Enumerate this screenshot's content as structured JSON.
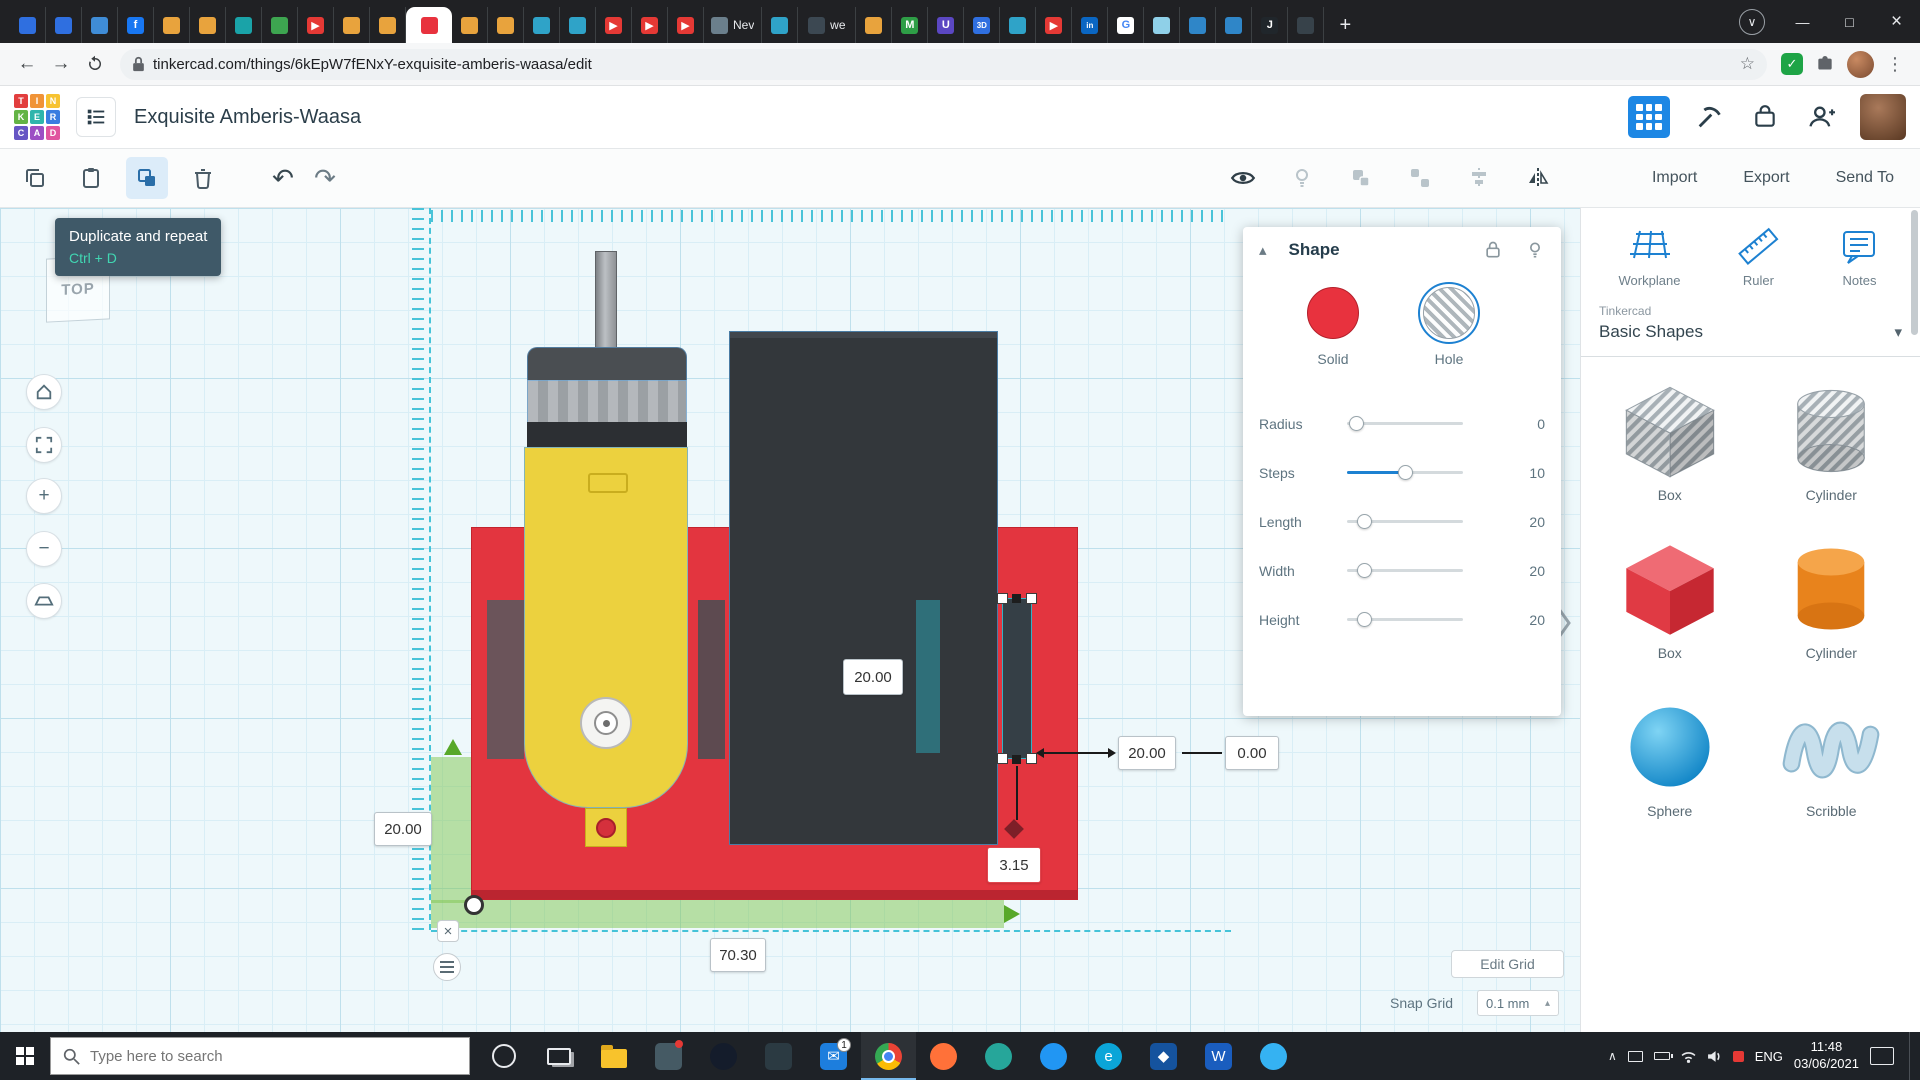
{
  "browser": {
    "tabs": [
      {
        "name": "translate",
        "color": "#2f6fe0"
      },
      {
        "name": "translate2",
        "color": "#2f6fe0"
      },
      {
        "name": "docs",
        "color": "#3f8cd6"
      },
      {
        "name": "facebook",
        "color": "#1877f2",
        "glyph": "f"
      },
      {
        "name": "amber1",
        "color": "#e8a33d"
      },
      {
        "name": "amber2",
        "color": "#e8a33d"
      },
      {
        "name": "maker",
        "color": "#1aa3a8"
      },
      {
        "name": "green",
        "color": "#3da550"
      },
      {
        "name": "youtube1",
        "color": "#e53935",
        "glyph": "▶"
      },
      {
        "name": "amber3",
        "color": "#e8a33d"
      },
      {
        "name": "amber4",
        "color": "#e8a33d"
      },
      {
        "name": "tinkercad",
        "color": "#e8323e",
        "active": true
      },
      {
        "name": "amber5",
        "color": "#e8a33d"
      },
      {
        "name": "amber6",
        "color": "#e8a33d"
      },
      {
        "name": "thing1",
        "color": "#2fa3c8"
      },
      {
        "name": "thing2",
        "color": "#2fa3c8"
      },
      {
        "name": "youtube2",
        "color": "#e53935",
        "glyph": "▶"
      },
      {
        "name": "youtube3",
        "color": "#e53935",
        "glyph": "▶"
      },
      {
        "name": "youtube4",
        "color": "#e53935",
        "glyph": "▶"
      },
      {
        "name": "nev",
        "color": "#6b7f8c",
        "label": "Nev"
      },
      {
        "name": "thing3",
        "color": "#2fa3c8"
      },
      {
        "name": "wetransfer",
        "color": "#3c4852",
        "label": "we"
      },
      {
        "name": "amber7",
        "color": "#e8a33d"
      },
      {
        "name": "gmail",
        "color": "#2e9e46",
        "glyph": "M"
      },
      {
        "name": "ultimaker",
        "color": "#5b47c2",
        "glyph": "U"
      },
      {
        "name": "threed",
        "color": "#2f6fe0",
        "glyph": "3D"
      },
      {
        "name": "thing4",
        "color": "#2fa3c8"
      },
      {
        "name": "youtube5",
        "color": "#e53935",
        "glyph": "▶"
      },
      {
        "name": "linkedin",
        "color": "#0a66c2",
        "glyph": "in"
      },
      {
        "name": "google",
        "color": "#ffffff",
        "glyph": "G",
        "glyph_color": "#4285f4"
      },
      {
        "name": "lightblue",
        "color": "#8fd0e8"
      },
      {
        "name": "blue1",
        "color": "#2f86c8"
      },
      {
        "name": "blue2",
        "color": "#2f86c8"
      },
      {
        "name": "darkj",
        "color": "#20262b",
        "glyph": "J"
      },
      {
        "name": "dark2",
        "color": "#37424a"
      }
    ],
    "new_tab_glyph": "+",
    "tab_search_glyph": "∨",
    "window_controls": {
      "minimize": "—",
      "maximize": "□",
      "close": "×"
    },
    "nav": {
      "back": "←",
      "forward": "→"
    },
    "url": "tinkercad.com/things/6kEpW7fENxY-exquisite-amberis-waasa/edit",
    "bookmark_glyph": "☆",
    "check_glyph": "✓",
    "kebab_glyph": "⋮"
  },
  "app_header": {
    "title": "Exquisite Amberis-Waasa",
    "logo_rows": [
      [
        "T",
        "I",
        "N"
      ],
      [
        "K",
        "E",
        "R"
      ],
      [
        "C",
        "A",
        "D"
      ]
    ]
  },
  "toolbar": {
    "undo_glyph": "↶",
    "redo_glyph": "↷",
    "import": "Import",
    "export": "Export",
    "send_to": "Send To"
  },
  "tooltip": {
    "title": "Duplicate and repeat",
    "shortcut": "Ctrl + D"
  },
  "viewcube": {
    "label": "TOP"
  },
  "canvas": {
    "zoom_in_glyph": "+",
    "zoom_out_glyph": "−",
    "dim_width": "20.00",
    "dim_right": "20.00",
    "dim_zero": "0.00",
    "dim_left": "20.00",
    "dim_gap": "3.15",
    "dim_bottom": "70.30",
    "ruler_close_glyph": "×",
    "edit_grid": "Edit Grid",
    "snap_grid_label": "Snap Grid",
    "snap_grid_value": "0.1 mm",
    "snap_caret": "▴"
  },
  "shape_panel": {
    "title": "Shape",
    "collapse_glyph": "▴",
    "options": [
      {
        "label": "Solid"
      },
      {
        "label": "Hole"
      }
    ],
    "sliders": [
      {
        "label": "Radius",
        "value": "0"
      },
      {
        "label": "Steps",
        "value": "10"
      },
      {
        "label": "Length",
        "value": "20"
      },
      {
        "label": "Width",
        "value": "20"
      },
      {
        "label": "Height",
        "value": "20"
      }
    ]
  },
  "sidebar": {
    "tools": [
      {
        "label": "Workplane"
      },
      {
        "label": "Ruler"
      },
      {
        "label": "Notes"
      }
    ],
    "library": "Tinkercad",
    "category": "Basic Shapes",
    "category_caret": "▾",
    "shapes": [
      {
        "label": "Box"
      },
      {
        "label": "Cylinder"
      },
      {
        "label": "Box"
      },
      {
        "label": "Cylinder"
      },
      {
        "label": "Sphere"
      },
      {
        "label": "Scribble"
      }
    ]
  },
  "taskbar": {
    "search_placeholder": "Type here to search",
    "apps": [
      {
        "name": "cortana",
        "kind": "ring"
      },
      {
        "name": "task-view",
        "kind": "taskview"
      },
      {
        "name": "file-explorer",
        "kind": "folder"
      },
      {
        "name": "microsoft-store",
        "kind": "square",
        "color": "#455a64",
        "dot": "#e53935"
      },
      {
        "name": "steam",
        "kind": "circle",
        "color": "#141c2b"
      },
      {
        "name": "game-bar",
        "kind": "square",
        "color": "#2b3a42"
      },
      {
        "name": "mail",
        "kind": "square",
        "color": "#1d7edd",
        "glyph": "✉",
        "badge": "1"
      },
      {
        "name": "chrome",
        "kind": "chrome",
        "active": true
      },
      {
        "name": "firefox",
        "kind": "circle",
        "color": "#ff7139"
      },
      {
        "name": "messaging",
        "kind": "circle",
        "color": "#26a69a"
      },
      {
        "name": "video-call",
        "kind": "circle",
        "color": "#2196f3"
      },
      {
        "name": "edge",
        "kind": "circle",
        "color": "#0ba5d8",
        "glyph": "e"
      },
      {
        "name": "dev-tool",
        "kind": "square",
        "color": "#15539e",
        "glyph": "◆"
      },
      {
        "name": "word",
        "kind": "square",
        "color": "#1a5dbe",
        "glyph": "W"
      },
      {
        "name": "browser",
        "kind": "circle",
        "color": "#35b2f2"
      }
    ],
    "tray_caret": "∧",
    "lang": "ENG",
    "time": "11:48",
    "date": "03/06/2021"
  }
}
